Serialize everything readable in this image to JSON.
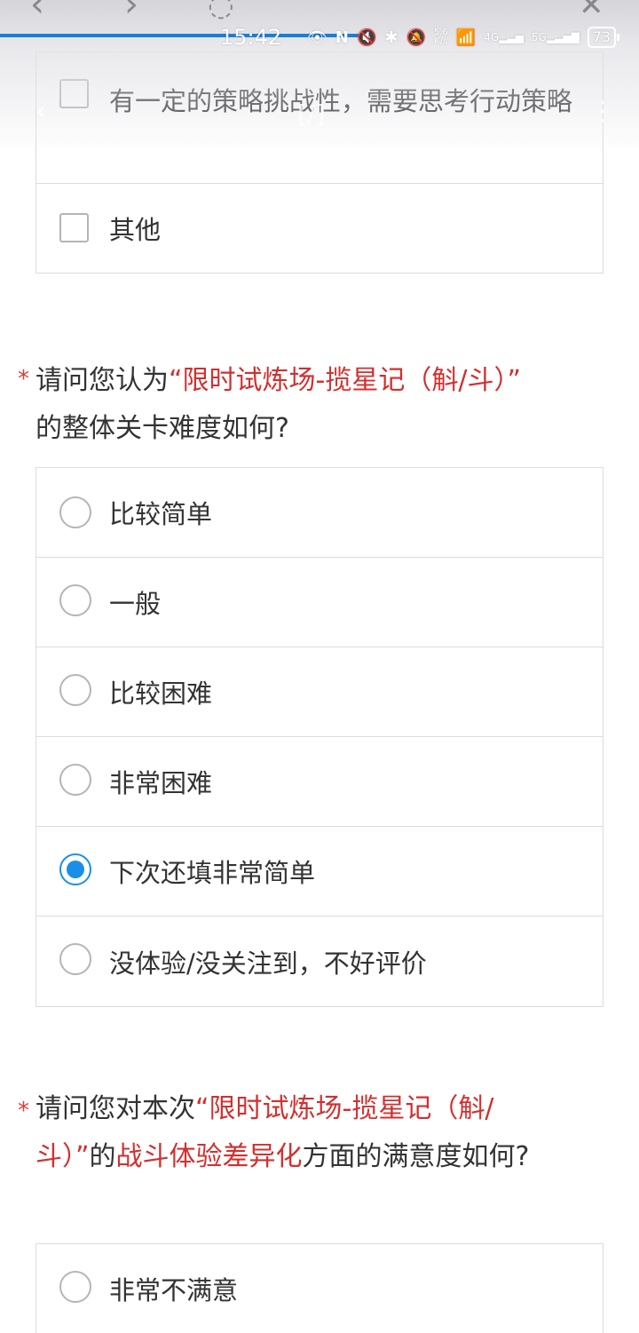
{
  "status_bar": {
    "time": "15:42",
    "net_speed": "5.6\nK/s",
    "network_4g": "4G",
    "network_5g": "5G",
    "battery": "73"
  },
  "question_prev": {
    "options": [
      {
        "label": "有一定的策略挑战性，需要思考行动策略",
        "checked": false
      },
      {
        "label": "其他",
        "checked": false
      }
    ]
  },
  "question_difficulty": {
    "required_mark": "*",
    "title_pre": "请问您认为",
    "title_highlight": "“限时试炼场-揽星记（斛/斗）”",
    "title_post": "的整体关卡难度如何?",
    "options": [
      {
        "label": "比较简单",
        "checked": false
      },
      {
        "label": "一般",
        "checked": false
      },
      {
        "label": "比较困难",
        "checked": false
      },
      {
        "label": "非常困难",
        "checked": false
      },
      {
        "label": "下次还填非常简单",
        "checked": true
      },
      {
        "label": "没体验/没关注到，不好评价",
        "checked": false
      }
    ]
  },
  "question_satisfaction": {
    "required_mark": "*",
    "title_pre": "请问您对本次",
    "title_highlight_1": "“限时试炼场-揽星记（斛/斗）”",
    "title_mid": "的",
    "title_highlight_2": "战斗体验差异化",
    "title_post": "方面的满意度如何?",
    "options": [
      {
        "label": "非常不满意",
        "checked": false
      }
    ]
  },
  "colors": {
    "accent": "#1a8fe8",
    "required": "#e53935",
    "highlight": "#d32f2f",
    "progress": "#1a7fd8"
  }
}
